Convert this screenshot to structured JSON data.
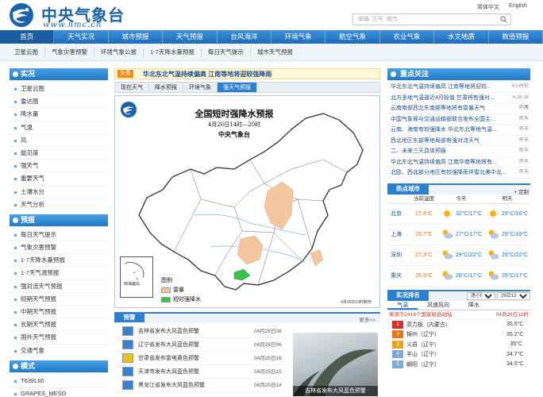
{
  "header": {
    "brand": "中央气象台",
    "url": "www.nmc.cn",
    "links": [
      "简体中文",
      "English"
    ],
    "search_placeholder": "邮编  区号  城市"
  },
  "mainnav": [
    "首页",
    "天气实况",
    "城市预报",
    "天气预报",
    "台风海洋",
    "环境气象",
    "航空气象",
    "农业气象",
    "水文地质",
    "数值预报"
  ],
  "subnav": [
    "卫星云图",
    "气象灾害预警",
    "环境气象公报",
    "1-7天降水量预报",
    "每日天气提示",
    "城市天气预报"
  ],
  "sidebar": {
    "realtime": {
      "title": "实况",
      "items": [
        "卫星云图",
        "雷达图",
        "降水量",
        "气温",
        "风",
        "能见度",
        "强天气",
        "重要天气",
        "土壤水分",
        "天气分析"
      ]
    },
    "forecast": {
      "title": "预报",
      "items": [
        "每日天气提示",
        "气象灾害预警",
        "1-7天降水量预报",
        "1-7天气温预报",
        "强对流天气预报",
        "短期天气预报",
        "中期天气预报",
        "长期天气预报",
        "国外天气预报",
        "交通气象"
      ]
    },
    "model": {
      "title": "模式",
      "items": [
        "T639L60",
        "GRAPES_MESO"
      ]
    }
  },
  "center": {
    "ticker_tag": "头条",
    "ticker_text": "华北东北气温持续偏高 江南等地将迎较强降雨",
    "tabs": [
      "现在天气",
      "降水预报",
      "环境气象",
      "强天气预报"
    ],
    "active_tab": 3,
    "map": {
      "title": "全国短时强降水预报",
      "date": "4月26日14时—20时",
      "agency": "中央气象台",
      "inset_label": "南海诸岛",
      "legend_title": "图例",
      "legend_items": [
        {
          "label": "雷暴",
          "color": "#f3c6a0"
        },
        {
          "label": "短时强降水",
          "color": "#39c24a"
        }
      ],
      "stamp": "4月26日10时制作"
    },
    "warnings": {
      "tab": "预警",
      "more": "更多>>",
      "items": [
        {
          "text": "吉林省发布大风蓝色预警",
          "date": "04月26日08",
          "color": "#3b7fd0"
        },
        {
          "text": "辽宁省发布大风蓝色预警",
          "date": "04月26日06",
          "color": "#3b7fd0"
        },
        {
          "text": "甘肃省发布雷电黄色预警",
          "date": "04月25日16",
          "color": "#e8c21e"
        },
        {
          "text": "天津市发布大风蓝色预警",
          "date": "04月25日15",
          "color": "#3b7fd0"
        },
        {
          "text": "黑龙江省发布大风蓝色预警",
          "date": "04月25日14",
          "color": "#3b7fd0"
        }
      ],
      "photo_caption": "吉林省发布大风蓝色预警"
    }
  },
  "right": {
    "focus": {
      "title": "重点关注",
      "items": [
        {
          "text": "华北东北气温持续偏高 江南等地将迎较...",
          "date": "4小时前"
        },
        {
          "text": "北方多地气温逼近4月极值 甘肃将有强对...",
          "date": "4-26 16时"
        },
        {
          "text": "云南南部西北东南部等地将有雷暴天气",
          "date": "昨天"
        },
        {
          "text": "中国气象局与交通运输部联合发布全国主...",
          "date": "昨天"
        },
        {
          "text": "云南、海南有较强降水 华北东北等地气温...",
          "date": "昨天"
        },
        {
          "text": "西北地区东部等地局部有强对流天气",
          "date": "昨天"
        },
        {
          "text": "二、未来三天具体预报",
          "date": "昨天"
        },
        {
          "text": "华北东北气温持续偏高 江南华南等地将有...",
          "date": "昨天"
        },
        {
          "text": "北欧、西北部分地区有较强降雨伴雷北美中北...",
          "date": "昨天"
        }
      ]
    },
    "hot": {
      "title": "热点城市",
      "more": "+ 定制",
      "cols": [
        "",
        "当前温度",
        "今天",
        "明天"
      ],
      "rows": [
        {
          "city": "北京",
          "temp": "27.8°C",
          "today": "32°C/17°C",
          "tomorrow": "29°C/16°C",
          "icon_today": "sun",
          "icon_tomorrow": "sun"
        },
        {
          "city": "上海",
          "temp": "26.7°C",
          "today": "27°C/17°C",
          "tomorrow": "29°C/18°C",
          "icon_today": "cloud",
          "icon_tomorrow": "cloud"
        },
        {
          "city": "深圳",
          "temp": "27.3°C",
          "today": "29°C/22°C",
          "tomorrow": "29°C/22°C",
          "icon_today": "cloud",
          "icon_tomorrow": "cloud"
        },
        {
          "city": "重庆",
          "temp": "26.9°C",
          "today": "26°C/17°C",
          "tomorrow": "25°C/17°C",
          "icon_today": "cloud",
          "icon_tomorrow": "cloud"
        }
      ]
    },
    "rank": {
      "title": "实况排名",
      "select1": "逐小时",
      "select2": "26日12时",
      "tabs": [
        "气温",
        "风速风向",
        "降水"
      ],
      "note_left": "来源于2418个国家级自动站",
      "note_right": "04月26日12时",
      "rows": [
        {
          "idx": "1",
          "station": "高力板（内蒙古）",
          "value": "35.5°C"
        },
        {
          "idx": "2",
          "station": "锦州（辽宁）",
          "value": "35.2°C"
        },
        {
          "idx": "3",
          "station": "义县（辽宁）",
          "value": "35°C"
        },
        {
          "idx": "4",
          "station": "羊山（辽宁）",
          "value": "34.7°C"
        },
        {
          "idx": "5",
          "station": "朝阳（辽宁）",
          "value": "34.5°C"
        }
      ]
    }
  }
}
